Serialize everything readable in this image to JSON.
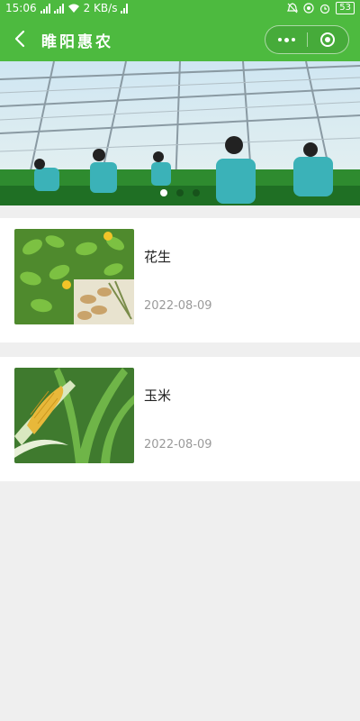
{
  "status_bar": {
    "time": "15:06",
    "signal1": "5G",
    "signal2": "4G",
    "speed": "2 KB/s",
    "signal3": "HD",
    "battery": "53"
  },
  "nav": {
    "title": "睢阳惠农"
  },
  "banner": {
    "dot_count": 3,
    "active_index": 0
  },
  "items": [
    {
      "title": "花生",
      "date": "2022-08-09"
    },
    {
      "title": "玉米",
      "date": "2022-08-09"
    }
  ],
  "colors": {
    "brand_green": "#4dba3f",
    "background": "#efefef"
  }
}
